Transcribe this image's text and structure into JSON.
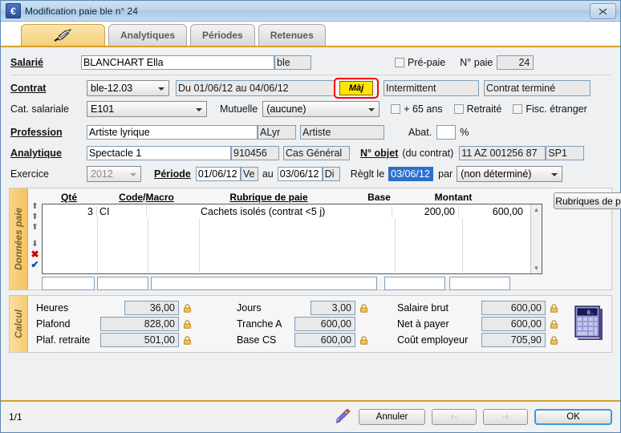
{
  "window": {
    "title": "Modification paie ble n° 24",
    "icon": "euro-icon",
    "close_label": "✕"
  },
  "tabs": [
    {
      "label": "",
      "icon": "quill-icon",
      "active": true
    },
    {
      "label": "Analytiques",
      "active": false
    },
    {
      "label": "Périodes",
      "active": false
    },
    {
      "label": "Retenues",
      "active": false
    }
  ],
  "form": {
    "salarie_label": "Salarié",
    "salarie_value": "BLANCHART Ella",
    "salarie_code": "ble",
    "prepaie_label": "Pré-paie",
    "nopaie_label": "N° paie",
    "nopaie_value": "24",
    "contrat_label": "Contrat",
    "contrat_combo": "ble-12.03",
    "contrat_dates": "Du 01/06/12 au 04/06/12",
    "maj_label": "Màj",
    "contrat_type": "Intermittent",
    "contrat_statut": "Contrat terminé",
    "cat_label": "Cat. salariale",
    "cat_combo": "E101",
    "mutuelle_label": "Mutuelle",
    "mutuelle_combo": "(aucune)",
    "plus65_label": "+ 65 ans",
    "retraite_label": "Retraité",
    "fisc_label": "Fisc. étranger",
    "profession_label": "Profession",
    "profession_value": "Artiste lyrique",
    "profession_code": "ALyr",
    "profession_cat": "Artiste",
    "abat_label": "Abat.",
    "abat_value": "",
    "abat_unit": "%",
    "analytique_label": "Analytique",
    "analytique_value": "Spectacle 1",
    "analytique_num": "910456",
    "analytique_cas": "Cas Général",
    "nobjet_label": "N° objet",
    "nobjet_sub": "(du contrat)",
    "nobjet_value": "11 AZ 001256 87",
    "nobjet_code": "SP1",
    "exercice_label": "Exercice",
    "exercice_value": "2012",
    "periode_label": "Période",
    "periode_from": "01/06/12",
    "periode_from_day": "Ve",
    "periode_au": "au",
    "periode_to": "03/06/12",
    "periode_to_day": "Di",
    "reglt_label": "Règlt le",
    "reglt_value": "03/06/12",
    "par_label": "par",
    "par_value": "(non déterminé)"
  },
  "donnees_paie": {
    "section_label": "Données paie",
    "columns": [
      "Qté",
      "Code",
      "/",
      "Macro",
      "Rubrique de paie",
      "Base",
      "Montant"
    ],
    "headers": {
      "qte": "Qté",
      "code": "Code",
      "slash": "/",
      "macro": "Macro",
      "rubrique": "Rubrique de paie",
      "base": "Base",
      "montant": "Montant"
    },
    "rows": [
      {
        "qte": "3",
        "code": "CI",
        "rubrique": "Cachets isolés (contrat <5 j)",
        "base": "200,00",
        "montant": "600,00"
      }
    ],
    "entry": {
      "qte": "",
      "code": "",
      "rubrique": "",
      "base": "",
      "montant": ""
    },
    "rubriques_button": "Rubriques de paie",
    "arrow_icons": [
      "move-top-icon",
      "move-up-icon",
      "move-down-icon",
      "move-bottom-icon",
      "delete-icon",
      "validate-icon"
    ]
  },
  "calcul": {
    "section_label": "Calcul",
    "col1": [
      {
        "label": "Heures",
        "value": "36,00",
        "locked": true
      },
      {
        "label": "Plafond",
        "value": "828,00",
        "locked": true
      },
      {
        "label": "Plaf. retraite",
        "value": "501,00",
        "locked": true
      }
    ],
    "col2": [
      {
        "label": "Jours",
        "value": "3,00",
        "locked": true
      },
      {
        "label": "Tranche A",
        "value": "600,00",
        "locked": false
      },
      {
        "label": "Base CS",
        "value": "600,00",
        "locked": true
      }
    ],
    "col3": [
      {
        "label": "Salaire brut",
        "value": "600,00",
        "locked": true
      },
      {
        "label": "Net à payer",
        "value": "600,00",
        "locked": true
      },
      {
        "label": "Coût employeur",
        "value": "705,90",
        "locked": true
      }
    ],
    "calculator_icon": "calculator-icon"
  },
  "footer": {
    "page": "1/1",
    "pencil_icon": "pencil-icon",
    "cancel": "Annuler",
    "prev": "‹-",
    "next": "-›",
    "ok": "OK"
  },
  "colors": {
    "accent_gold": "#d5a028",
    "highlight_yellow": "#ffe400",
    "annotation_red": "#ff0000",
    "selection_blue": "#2a6fd0",
    "titlebar_blue": "#a8c8e5"
  }
}
